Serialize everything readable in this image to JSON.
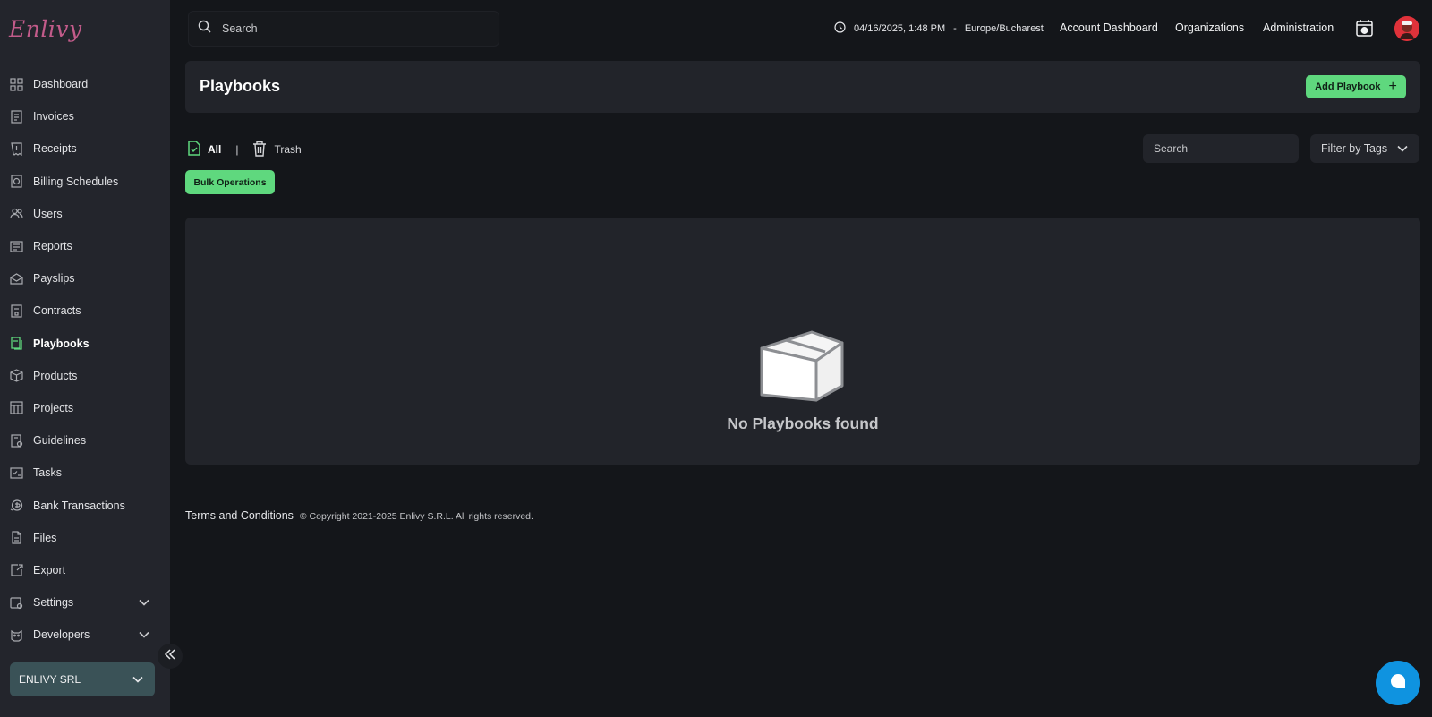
{
  "brand": {
    "logo_text": "Enlivy"
  },
  "sidebar": {
    "items": [
      {
        "label": "Dashboard",
        "icon": "dashboard-icon"
      },
      {
        "label": "Invoices",
        "icon": "invoice-icon"
      },
      {
        "label": "Receipts",
        "icon": "receipt-icon"
      },
      {
        "label": "Billing Schedules",
        "icon": "billing-schedule-icon"
      },
      {
        "label": "Users",
        "icon": "users-icon"
      },
      {
        "label": "Reports",
        "icon": "reports-icon"
      },
      {
        "label": "Payslips",
        "icon": "payslip-icon"
      },
      {
        "label": "Contracts",
        "icon": "contract-icon"
      },
      {
        "label": "Playbooks",
        "icon": "playbook-icon"
      },
      {
        "label": "Products",
        "icon": "product-box-icon"
      },
      {
        "label": "Projects",
        "icon": "projects-icon"
      },
      {
        "label": "Guidelines",
        "icon": "guidelines-icon"
      },
      {
        "label": "Tasks",
        "icon": "tasks-icon"
      },
      {
        "label": "Bank Transactions",
        "icon": "bank-transaction-icon"
      },
      {
        "label": "Files",
        "icon": "file-icon"
      },
      {
        "label": "Export",
        "icon": "export-icon"
      },
      {
        "label": "Settings",
        "icon": "settings-icon"
      },
      {
        "label": "Developers",
        "icon": "developers-icon"
      }
    ],
    "active": "Playbooks",
    "company": "ENLIVY SRL"
  },
  "topbar": {
    "search_placeholder": "Search",
    "datetime": "04/16/2025, 1:48 PM",
    "timezone": "Europe/Bucharest",
    "links": [
      "Account Dashboard",
      "Organizations",
      "Administration"
    ]
  },
  "page": {
    "title": "Playbooks",
    "add_button": "Add Playbook",
    "tabs": {
      "all": "All",
      "trash": "Trash"
    },
    "filter_search_placeholder": "Search",
    "filter_tags": "Filter by Tags",
    "bulk_button": "Bulk Operations",
    "empty_text": "No Playbooks found"
  },
  "footer": {
    "terms": "Terms and Conditions",
    "copyright": "© Copyright 2021-2025 Enlivy S.R.L. All rights reserved."
  },
  "colors": {
    "accent": "#5fd87e",
    "sidebar_bg": "#23252c",
    "page_bg": "#14161a",
    "card_bg": "#22242a",
    "chat": "#0f93e0",
    "avatar": "#e0323a"
  }
}
